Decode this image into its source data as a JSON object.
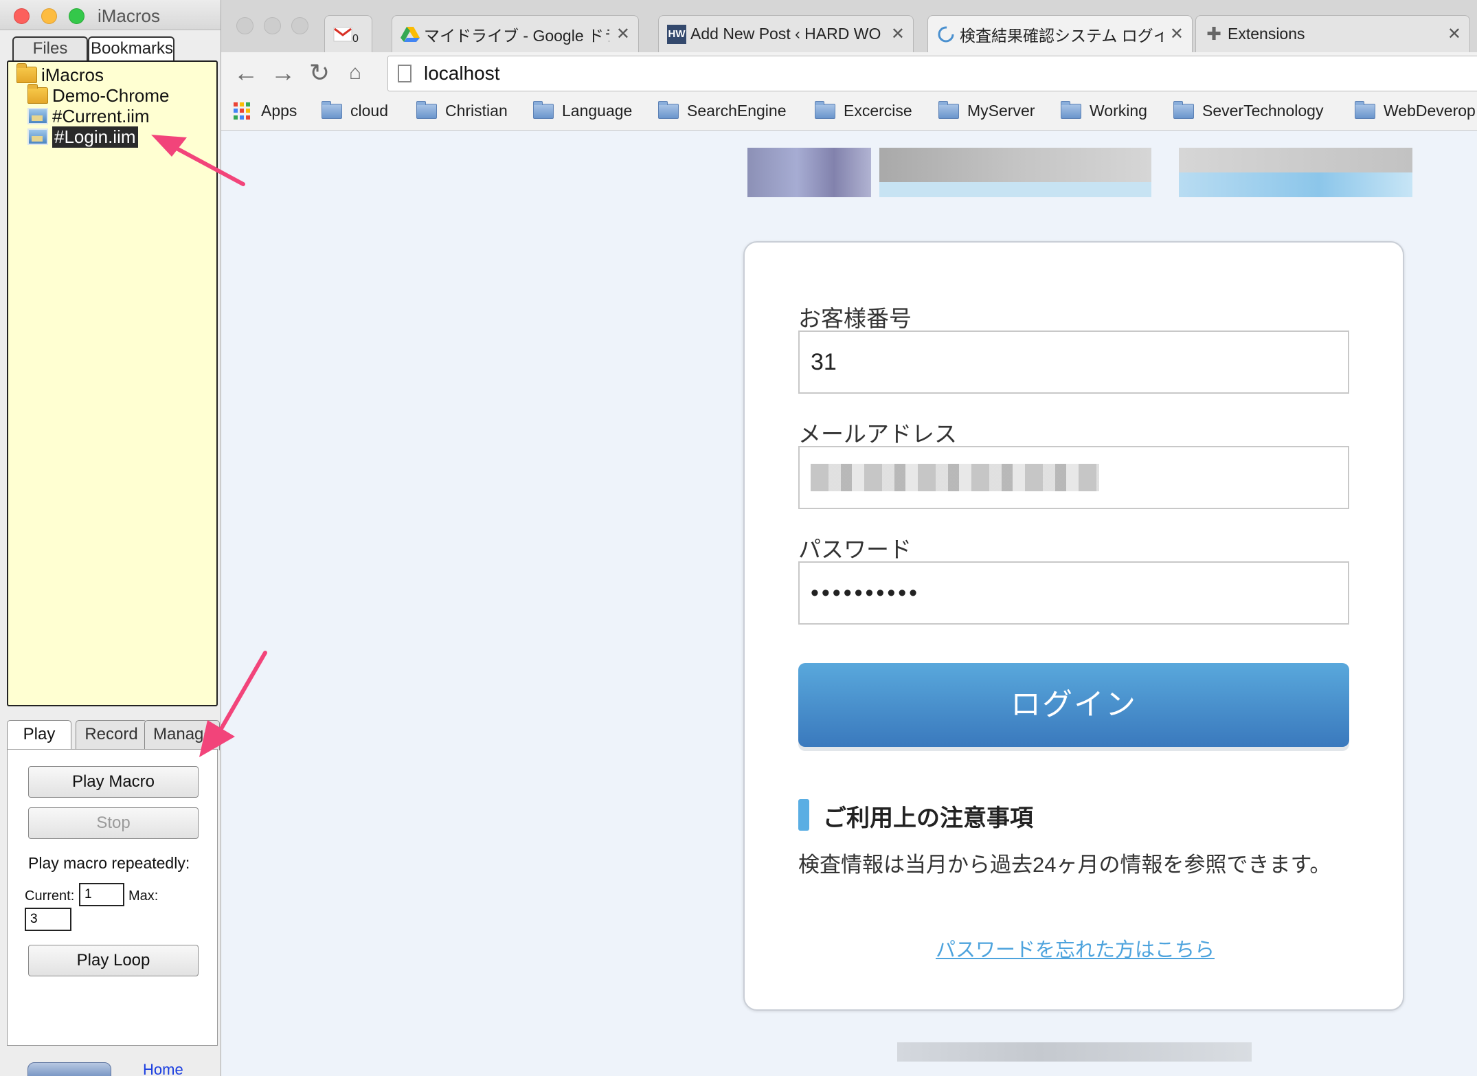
{
  "imacros": {
    "window_title": "iMacros",
    "top_tabs": {
      "files": "Files",
      "bookmarks": "Bookmarks"
    },
    "tree": [
      {
        "label": "iMacros",
        "type": "folder"
      },
      {
        "label": "Demo-Chrome",
        "type": "folder"
      },
      {
        "label": "#Current.iim",
        "type": "macro"
      },
      {
        "label": "#Login.iim",
        "type": "macro",
        "selected": true
      }
    ],
    "bottom_tabs": {
      "play": "Play",
      "record": "Record",
      "manage": "Manage"
    },
    "play_panel": {
      "play_macro": "Play Macro",
      "stop": "Stop",
      "repeat_label": "Play macro repeatedly:",
      "current_label": "Current:",
      "current_value": "1",
      "max_label": "Max:",
      "max_value": "3",
      "play_loop": "Play Loop"
    },
    "home_link": "Home"
  },
  "browser": {
    "tabs": [
      {
        "label": "",
        "favicon": "gmail-icon",
        "badge": "0"
      },
      {
        "label": "マイドライブ - Google ドラ",
        "favicon": "google-drive-icon"
      },
      {
        "label": "Add New Post ‹ HARD WO",
        "favicon": "hw-icon"
      },
      {
        "label": "検査結果確認システム ログイ",
        "favicon": "loading-icon",
        "active": true
      },
      {
        "label": "Extensions",
        "favicon": "puzzle-icon"
      }
    ],
    "url": "localhost",
    "bookmarks": [
      "Apps",
      "cloud",
      "Christian",
      "Language",
      "SearchEngine",
      "Excercise",
      "MyServer",
      "Working",
      "SeverTechnology",
      "WebDeverop"
    ]
  },
  "login": {
    "customer_label": "お客様番号",
    "customer_value": "31",
    "email_label": "メールアドレス",
    "password_label": "パスワード",
    "password_value": "••••••••••",
    "login_button": "ログイン",
    "notice_title": "ご利用上の注意事項",
    "notice_text": "検査情報は当月から過去24ヶ月の情報を参照できます。",
    "forgot_link": "パスワードを忘れた方はこちら"
  },
  "colors": {
    "accent_arrow": "#f2447a",
    "login_button": "#4a90cf",
    "link": "#4da3dd"
  }
}
